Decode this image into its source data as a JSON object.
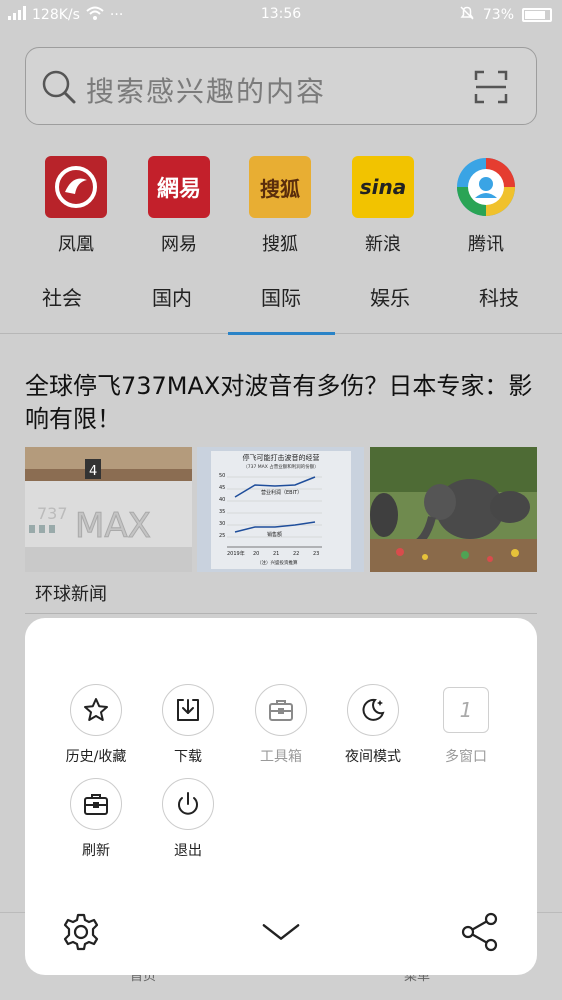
{
  "status_bar": {
    "network_speed": "128K/s",
    "more": "···",
    "time": "13:56",
    "battery_percent": "73%"
  },
  "search": {
    "placeholder": "搜索感兴趣的内容"
  },
  "sites": [
    {
      "label": "凤凰",
      "logo_icon": "ifeng-logo",
      "color": "#c8252a"
    },
    {
      "label": "网易",
      "logo_icon": "netease-logo",
      "color": "#c91f2b"
    },
    {
      "label": "搜狐",
      "logo_icon": "sohu-logo",
      "color": "#e9b034"
    },
    {
      "label": "新浪",
      "logo_icon": "sina-logo",
      "color": "#f2c300"
    },
    {
      "label": "腾讯",
      "logo_icon": "tencent-news-logo",
      "color": "#3aa4e5"
    }
  ],
  "tabs": [
    {
      "label": "社会"
    },
    {
      "label": "国内"
    },
    {
      "label": "国际",
      "active": true
    },
    {
      "label": "娱乐"
    },
    {
      "label": "科技"
    }
  ],
  "article": {
    "headline": "全球停飞737MAX对波音有多伤？日本专家：影响有限！",
    "source": "环球新闻",
    "chart_thumb": {
      "title": "停飞可能打击波音的经营",
      "subtitle": "（737 MAX 占营业额和利润的份额）",
      "line1": "营业利润（EBIT）",
      "line2": "销售额",
      "years": [
        "2019年",
        "20",
        "21",
        "22",
        "23"
      ],
      "y_ticks": [
        "50",
        "45",
        "40",
        "35",
        "30",
        "25"
      ],
      "note": "（注）兴盛投资推算"
    }
  },
  "menu": {
    "items": [
      {
        "label": "历史/收藏",
        "icon": "star-icon",
        "enabled": true
      },
      {
        "label": "下载",
        "icon": "download-icon",
        "enabled": true
      },
      {
        "label": "工具箱",
        "icon": "toolbox-icon",
        "enabled": false
      },
      {
        "label": "夜间模式",
        "icon": "moon-icon",
        "enabled": true
      },
      {
        "label": "多窗口",
        "icon": "windows-icon",
        "enabled": false,
        "count": "1"
      },
      {
        "label": "刷新",
        "icon": "refresh-icon",
        "enabled": true
      },
      {
        "label": "退出",
        "icon": "power-icon",
        "enabled": true
      }
    ]
  },
  "bottom_nav": {
    "home": "首页",
    "menu": "菜单"
  },
  "colors": {
    "accent": "#2a83c7",
    "background": "#cfcfcf",
    "menu_bg": "#ffffff"
  }
}
